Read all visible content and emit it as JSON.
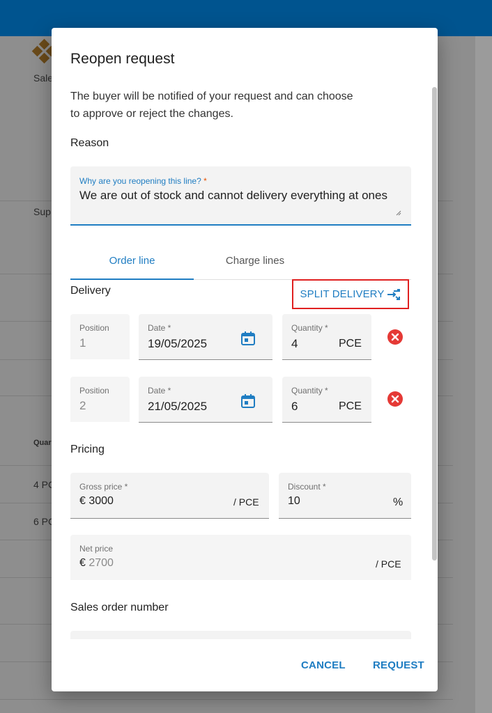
{
  "background": {
    "sales_label": "Sale",
    "supplier_label": "Sup",
    "quantity_header": "Quar",
    "row1_qty": "4 PC",
    "row2_qty": "6 PC"
  },
  "dialog": {
    "title": "Reopen request",
    "description": "The buyer will be notified of your request and can choose to approve or reject the changes.",
    "reason_label": "Reason",
    "reason_field": {
      "label": "Why are you reopening this line?",
      "required_mark": "*",
      "value": "We are out of stock and cannot delivery everything at ones"
    },
    "tabs": [
      {
        "label": "Order line",
        "active": true
      },
      {
        "label": "Charge lines",
        "active": false
      }
    ],
    "delivery_label": "Delivery",
    "split_delivery_label": "SPLIT DELIVERY",
    "deliveries": [
      {
        "position_label": "Position",
        "position": "1",
        "date_label": "Date *",
        "date": "19/05/2025",
        "quantity_label": "Quantity *",
        "quantity": "4",
        "unit": "PCE"
      },
      {
        "position_label": "Position",
        "position": "2",
        "date_label": "Date *",
        "date": "21/05/2025",
        "quantity_label": "Quantity *",
        "quantity": "6",
        "unit": "PCE"
      }
    ],
    "pricing_label": "Pricing",
    "gross_price": {
      "label": "Gross price *",
      "currency": "€",
      "value": "3000",
      "unit": "/ PCE"
    },
    "discount": {
      "label": "Discount *",
      "value": "10",
      "unit": "%"
    },
    "net_price": {
      "label": "Net price",
      "currency": "€",
      "value": "2700",
      "unit": "/ PCE"
    },
    "sales_order_label": "Sales order number",
    "cancel_label": "CANCEL",
    "request_label": "REQUEST"
  },
  "colors": {
    "primary": "#1f7dc2",
    "topbar": "#00548f",
    "highlight_border": "#e02020",
    "delete_icon": "#e53935"
  }
}
